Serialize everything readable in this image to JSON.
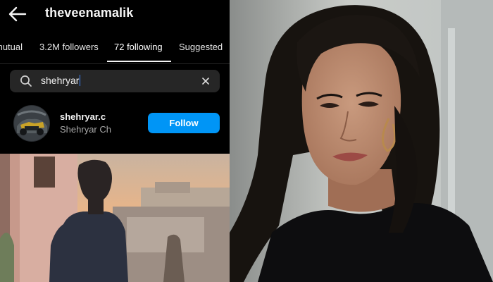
{
  "header": {
    "title": "theveenamalik",
    "back_icon": "arrow-left-icon"
  },
  "tabs": [
    {
      "label": "mutual",
      "active": false
    },
    {
      "label": "3.2M followers",
      "active": false
    },
    {
      "label": "72 following",
      "active": true
    },
    {
      "label": "Suggested",
      "active": false
    }
  ],
  "search": {
    "value": "shehryar",
    "icons": {
      "search": "search-icon",
      "clear": "close-icon"
    }
  },
  "result": {
    "handle": "shehryar.c",
    "name": "Shehryar Ch",
    "button_label": "Follow"
  },
  "colors": {
    "background": "#000000",
    "accent_button": "#0095f6",
    "search_field": "#262626",
    "secondary_text": "#a8a8a8"
  }
}
